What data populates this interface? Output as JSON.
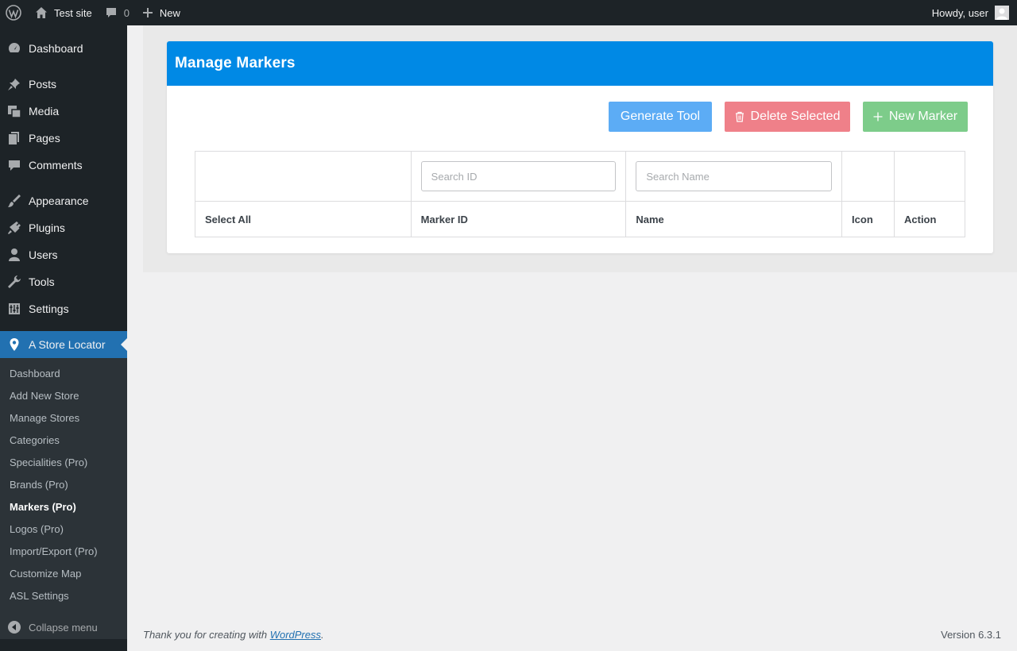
{
  "admin_bar": {
    "site_name": "Test site",
    "comments_count": "0",
    "new_label": "New",
    "greeting": "Howdy, user"
  },
  "sidebar": {
    "items": [
      {
        "label": "Dashboard",
        "icon": "dashboard-icon"
      },
      {
        "label": "Posts",
        "icon": "pin-icon"
      },
      {
        "label": "Media",
        "icon": "media-icon"
      },
      {
        "label": "Pages",
        "icon": "pages-icon"
      },
      {
        "label": "Comments",
        "icon": "comment-icon"
      },
      {
        "label": "Appearance",
        "icon": "brush-icon"
      },
      {
        "label": "Plugins",
        "icon": "plug-icon"
      },
      {
        "label": "Users",
        "icon": "user-icon"
      },
      {
        "label": "Tools",
        "icon": "wrench-icon"
      },
      {
        "label": "Settings",
        "icon": "settings-icon"
      },
      {
        "label": "A Store Locator",
        "icon": "location-pin-icon"
      }
    ],
    "submenu": [
      "Dashboard",
      "Add New Store",
      "Manage Stores",
      "Categories",
      "Specialities (Pro)",
      "Brands (Pro)",
      "Markers (Pro)",
      "Logos (Pro)",
      "Import/Export (Pro)",
      "Customize Map",
      "ASL Settings"
    ],
    "current_submenu": "Markers (Pro)",
    "collapse_label": "Collapse menu"
  },
  "main": {
    "title": "Manage Markers",
    "buttons": {
      "generate": "Generate Tool",
      "delete": "Delete Selected",
      "new_marker": "New Marker"
    },
    "search": {
      "id_placeholder": "Search ID",
      "name_placeholder": "Search Name"
    },
    "table": {
      "columns": [
        "Select All",
        "Marker ID",
        "Name",
        "Icon",
        "Action"
      ]
    }
  },
  "footer": {
    "thanks_prefix": "Thank you for creating with ",
    "link_text": "WordPress",
    "thanks_suffix": ".",
    "version": "Version 6.3.1"
  },
  "colors": {
    "header_blue": "#0089e5",
    "generate_button": "#5cacf5",
    "delete_button": "#ef8089",
    "new_button": "#7dcc8a",
    "sidebar_bg": "#1d2327",
    "sidebar_current": "#2271b1"
  }
}
